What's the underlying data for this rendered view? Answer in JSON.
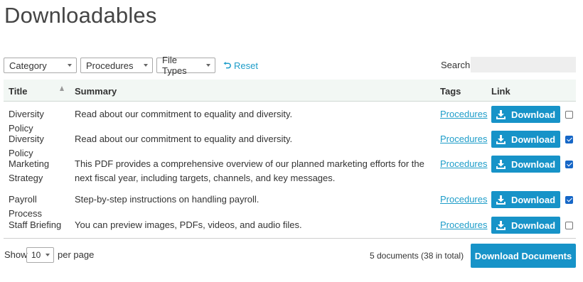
{
  "page": {
    "title": "Downloadables"
  },
  "filters": {
    "category": "Category",
    "procedures": "Procedures",
    "file_types": "File Types",
    "reset_label": "Reset"
  },
  "search": {
    "label": "Search:",
    "value": "",
    "placeholder": ""
  },
  "table": {
    "headers": {
      "title": "Title",
      "summary": "Summary",
      "tags": "Tags",
      "link": "Link"
    },
    "sort": {
      "column": "Title",
      "direction": "ascending"
    },
    "download_label": "Download",
    "rows": [
      {
        "title": "Diversity Policy",
        "summary": "Read about our commitment to equality and diversity.",
        "tag": "Procedures",
        "checked": false
      },
      {
        "title": "Diversity Policy",
        "summary": "Read about our commitment to equality and diversity.",
        "tag": "Procedures",
        "checked": true
      },
      {
        "title": "Marketing Strategy",
        "summary": "This PDF provides a comprehensive overview of our planned marketing efforts for the next fiscal year, including targets, channels, and key messages.",
        "tag": "Procedures",
        "checked": true
      },
      {
        "title": "Payroll Process",
        "summary": "Step-by-step instructions on handling payroll.",
        "tag": "Procedures",
        "checked": true
      },
      {
        "title": "Staff Briefing",
        "summary": "You can preview images, PDFs, videos, and audio files.",
        "tag": "Procedures",
        "checked": false
      }
    ]
  },
  "footer": {
    "show_label": "Show",
    "per_page_value": "10",
    "per_page_label": "per page",
    "count_text": "5 documents (38 in total)",
    "download_documents_label": "Download Documents"
  },
  "colors": {
    "accent": "#1793c8",
    "link": "#1e9dc9",
    "header_bg": "#f2f7f4",
    "checkbox_on": "#1667c7"
  },
  "icons": {
    "reset": "undo-arrow-icon",
    "download": "download-icon",
    "sort": "sort-ascending-icon",
    "dropdown": "chevron-down-icon"
  }
}
